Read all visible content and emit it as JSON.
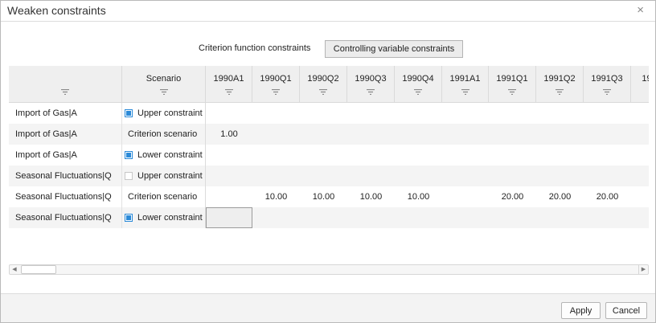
{
  "dialog": {
    "title": "Weaken constraints",
    "close_glyph": "×"
  },
  "tabs": [
    {
      "label": "Criterion function constraints",
      "active": false
    },
    {
      "label": "Controlling variable constraints",
      "active": true
    }
  ],
  "grid": {
    "columns": [
      {
        "label": ""
      },
      {
        "label": "Scenario"
      },
      {
        "label": "1990A1"
      },
      {
        "label": "1990Q1"
      },
      {
        "label": "1990Q2"
      },
      {
        "label": "1990Q3"
      },
      {
        "label": "1990Q4"
      },
      {
        "label": "1991A1"
      },
      {
        "label": "1991Q1"
      },
      {
        "label": "1991Q2"
      },
      {
        "label": "1991Q3"
      },
      {
        "label": "19"
      }
    ],
    "rows": [
      {
        "name": "Import of Gas|A",
        "scenario": "Upper constraint",
        "checkbox": true,
        "checked": true,
        "values": [
          "",
          "",
          "",
          "",
          "",
          "",
          "",
          "",
          "",
          ""
        ]
      },
      {
        "name": "Import of Gas|A",
        "scenario": "Criterion scenario",
        "checkbox": false,
        "checked": false,
        "values": [
          "1.00",
          "",
          "",
          "",
          "",
          "",
          "",
          "",
          "",
          ""
        ]
      },
      {
        "name": "Import of Gas|A",
        "scenario": "Lower constraint",
        "checkbox": true,
        "checked": true,
        "values": [
          "",
          "",
          "",
          "",
          "",
          "",
          "",
          "",
          "",
          ""
        ]
      },
      {
        "name": "Seasonal Fluctuations|Q",
        "scenario": "Upper constraint",
        "checkbox": true,
        "checked": false,
        "values": [
          "",
          "",
          "",
          "",
          "",
          "",
          "",
          "",
          "",
          ""
        ]
      },
      {
        "name": "Seasonal Fluctuations|Q",
        "scenario": "Criterion scenario",
        "checkbox": false,
        "checked": false,
        "values": [
          "",
          "10.00",
          "10.00",
          "10.00",
          "10.00",
          "",
          "20.00",
          "20.00",
          "20.00",
          ""
        ]
      },
      {
        "name": "Seasonal Fluctuations|Q",
        "scenario": "Lower constraint",
        "checkbox": true,
        "checked": true,
        "values": [
          "",
          "",
          "",
          "",
          "",
          "",
          "",
          "",
          "",
          ""
        ]
      }
    ]
  },
  "scrollbar": {
    "left_glyph": "◀",
    "right_glyph": "▶"
  },
  "footer": {
    "apply_label": "Apply",
    "cancel_label": "Cancel"
  },
  "colors": {
    "accent": "#2b8ad8",
    "header_bg": "#efefef",
    "alt_row": "#f4f4f4"
  },
  "icons": {
    "filter": "filter-icon",
    "close": "close-icon"
  }
}
